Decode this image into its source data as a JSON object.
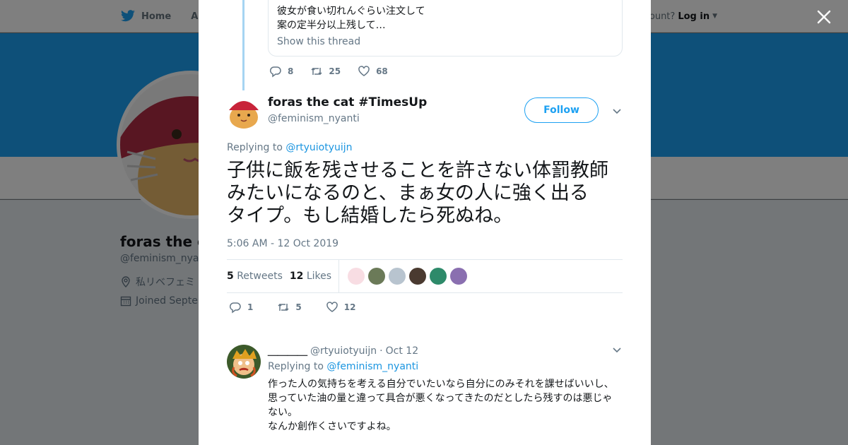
{
  "background": {
    "nav": {
      "home_label": "Home",
      "about_label": "Abo",
      "account_prompt": "ccount?",
      "login_label": "Log in"
    },
    "profile": {
      "name": "foras the ca",
      "handle": "@feminism_nyant",
      "location": "私リベフェミ",
      "joined": "Joined Septen"
    }
  },
  "thread": {
    "quote_lines": [
      "彼女が食い切れんぐらい注文して",
      "案の定半分以上残して…"
    ],
    "show_thread": "Show this thread",
    "actions": {
      "replies": "8",
      "retweets": "25",
      "likes": "68"
    }
  },
  "tweet": {
    "name": "foras the cat #TimesUp",
    "handle": "@feminism_nyanti",
    "follow_label": "Follow",
    "replying_prefix": "Replying to",
    "replying_to": "@rtyuiotyuijn",
    "text_lines": [
      "子供に飯を残させることを許さない体罰教師",
      "みたいになるのと、まぁ女の人に強く出る",
      "タイプ。もし結婚したら死ぬね。"
    ],
    "timestamp": "5:06 AM - 12 Oct 2019",
    "stats": {
      "retweets_count": "5",
      "retweets_label": "Retweets",
      "likes_count": "12",
      "likes_label": "Likes"
    },
    "actions": {
      "replies": "1",
      "retweets": "5",
      "likes": "12"
    }
  },
  "reply": {
    "name": "＿＿＿＿",
    "handle": "@rtyuiotyuijn",
    "separator": "·",
    "date": "Oct 12",
    "replying_prefix": "Replying to",
    "replying_to": "@feminism_nyanti",
    "text_lines": [
      "作った人の気持ちを考える自分でいたいなら自分にのみそれを課せばいいし、",
      "思っていた油の量と違って具合が悪くなってきたのだとしたら残すのは悪じゃ",
      "ない。",
      "なんか創作くさいですよね。"
    ]
  },
  "colors": {
    "accent": "#1da1f2",
    "link": "#1b95e0",
    "muted": "#657786",
    "text": "#14171a"
  }
}
